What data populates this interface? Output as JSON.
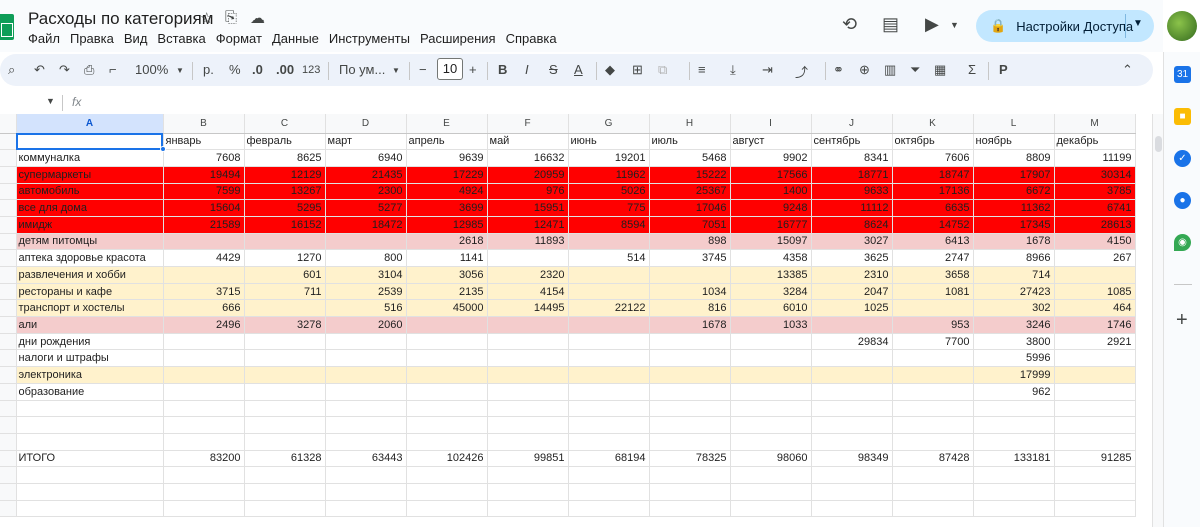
{
  "document": {
    "title": "Расходы по категориям",
    "star_icon": "star-icon",
    "move_icon": "folder-move-icon",
    "cloud_icon": "cloud-status-icon"
  },
  "menu": [
    "Файл",
    "Правка",
    "Вид",
    "Вставка",
    "Формат",
    "Данные",
    "Инструменты",
    "Расширения",
    "Справка"
  ],
  "header": {
    "share_label": "Настройки Доступа",
    "history_icon": "history-icon",
    "comments_icon": "comments-icon",
    "meet_icon": "video-call-icon",
    "lock_icon": "lock-icon"
  },
  "toolbar": {
    "zoom": "100%",
    "currency": "р.",
    "percent": "%",
    "decimal_decrease": ".0",
    "decimal_increase": ".00",
    "number_format": "123",
    "font": "По ум...",
    "font_size": "10",
    "bold": "B",
    "italic": "I",
    "strike": "S",
    "text_color": "A",
    "minus": "−",
    "plus": "+",
    "sigma": "Σ"
  },
  "formula_bar": {
    "fx": "fx",
    "value": ""
  },
  "grid": {
    "columns": [
      "A",
      "B",
      "C",
      "D",
      "E",
      "F",
      "G",
      "H",
      "I",
      "J",
      "K",
      "L",
      "M"
    ],
    "row_numbers": [
      "",
      "",
      "",
      "",
      "",
      "",
      "",
      "",
      "",
      "",
      "",
      "",
      "",
      "",
      "",
      "",
      "",
      "",
      "",
      "",
      "",
      "",
      "",
      ""
    ],
    "header_row": [
      "",
      "январь",
      "февраль",
      "март",
      "апрель",
      "май",
      "июнь",
      "июль",
      "август",
      "сентябрь",
      "октябрь",
      "ноябрь",
      "декабрь"
    ],
    "rows": [
      {
        "fill": "#ffffff",
        "cells": [
          "коммуналка",
          "7608",
          "8625",
          "6940",
          "9639",
          "16632",
          "19201",
          "5468",
          "9902",
          "8341",
          "7606",
          "8809",
          "11199"
        ]
      },
      {
        "fill": "#ff0000",
        "cells": [
          "супермаркеты",
          "19494",
          "12129",
          "21435",
          "17229",
          "20959",
          "11962",
          "15222",
          "17566",
          "18771",
          "18747",
          "17907",
          "30314"
        ]
      },
      {
        "fill": "#ff0000",
        "cells": [
          "автомобиль",
          "7599",
          "13267",
          "2300",
          "4924",
          "976",
          "5026",
          "25367",
          "1400",
          "9633",
          "17136",
          "6672",
          "3785"
        ]
      },
      {
        "fill": "#ff0000",
        "cells": [
          "все для дома",
          "15604",
          "5295",
          "5277",
          "3699",
          "15951",
          "775",
          "17046",
          "9248",
          "11112",
          "6635",
          "11362",
          "6741"
        ]
      },
      {
        "fill": "#ff0000",
        "cells": [
          "имидж",
          "21589",
          "16152",
          "18472",
          "12985",
          "12471",
          "8594",
          "7051",
          "16777",
          "8624",
          "14752",
          "17345",
          "28613"
        ]
      },
      {
        "fill": "#f4cccc",
        "cells": [
          "детям питомцы",
          "",
          "",
          "",
          "2618",
          "11893",
          "",
          "898",
          "15097",
          "3027",
          "6413",
          "1678",
          "4150"
        ]
      },
      {
        "fill": "#ffffff",
        "cells": [
          "аптека здоровье красота",
          "4429",
          "1270",
          "800",
          "1141",
          "",
          "514",
          "3745",
          "4358",
          "3625",
          "2747",
          "8966",
          "267"
        ]
      },
      {
        "fill": "#fff2cc",
        "cells": [
          "развлечения и хобби",
          "",
          "601",
          "3104",
          "3056",
          "2320",
          "",
          "",
          "13385",
          "2310",
          "3658",
          "714",
          ""
        ]
      },
      {
        "fill": "#fff2cc",
        "cells": [
          "рестораны и кафе",
          "3715",
          "711",
          "2539",
          "2135",
          "4154",
          "",
          "1034",
          "3284",
          "2047",
          "1081",
          "27423",
          "1085"
        ]
      },
      {
        "fill": "#fff2cc",
        "cells": [
          "транспорт и хостелы",
          "666",
          "",
          "516",
          "45000",
          "14495",
          "22122",
          "816",
          "6010",
          "1025",
          "",
          "302",
          "464"
        ]
      },
      {
        "fill": "#f4cccc",
        "cells": [
          "али",
          "2496",
          "3278",
          "2060",
          "",
          "",
          "",
          "1678",
          "1033",
          "",
          "953",
          "3246",
          "1746"
        ]
      },
      {
        "fill": "#ffffff",
        "cells": [
          "дни рождения",
          "",
          "",
          "",
          "",
          "",
          "",
          "",
          "",
          "29834",
          "7700",
          "3800",
          "2921"
        ]
      },
      {
        "fill": "#ffffff",
        "cells": [
          "налоги и штрафы",
          "",
          "",
          "",
          "",
          "",
          "",
          "",
          "",
          "",
          "",
          "5996",
          ""
        ]
      },
      {
        "fill": "#fff2cc",
        "cells": [
          "электроника",
          "",
          "",
          "",
          "",
          "",
          "",
          "",
          "",
          "",
          "",
          "17999",
          ""
        ]
      },
      {
        "fill": "#ffffff",
        "cells": [
          "образование",
          "",
          "",
          "",
          "",
          "",
          "",
          "",
          "",
          "",
          "",
          "962",
          ""
        ]
      },
      {
        "fill": "#ffffff",
        "cells": [
          "",
          "",
          "",
          "",
          "",
          "",
          "",
          "",
          "",
          "",
          "",
          "",
          ""
        ]
      },
      {
        "fill": "#ffffff",
        "cells": [
          "",
          "",
          "",
          "",
          "",
          "",
          "",
          "",
          "",
          "",
          "",
          "",
          ""
        ]
      },
      {
        "fill": "#ffffff",
        "cells": [
          "",
          "",
          "",
          "",
          "",
          "",
          "",
          "",
          "",
          "",
          "",
          "",
          ""
        ]
      },
      {
        "fill": "#ffffff",
        "cells": [
          "ИТОГО",
          "83200",
          "61328",
          "63443",
          "102426",
          "99851",
          "68194",
          "78325",
          "98060",
          "98349",
          "87428",
          "133181",
          "91285"
        ]
      },
      {
        "fill": "#ffffff",
        "cells": [
          "",
          "",
          "",
          "",
          "",
          "",
          "",
          "",
          "",
          "",
          "",
          "",
          ""
        ]
      },
      {
        "fill": "#ffffff",
        "cells": [
          "",
          "",
          "",
          "",
          "",
          "",
          "",
          "",
          "",
          "",
          "",
          "",
          ""
        ]
      },
      {
        "fill": "#ffffff",
        "cells": [
          "",
          "",
          "",
          "",
          "",
          "",
          "",
          "",
          "",
          "",
          "",
          "",
          ""
        ]
      }
    ]
  },
  "side_panel": {
    "icons": [
      "calendar-icon",
      "keep-icon",
      "tasks-icon",
      "contacts-icon",
      "maps-icon"
    ],
    "add_label": "+"
  },
  "colors": {
    "red_fill": "#ff0000",
    "pink_fill": "#f4cccc",
    "yellow_fill": "#fff2cc",
    "share_bg": "#c2e7ff",
    "selection": "#1a73e8"
  }
}
